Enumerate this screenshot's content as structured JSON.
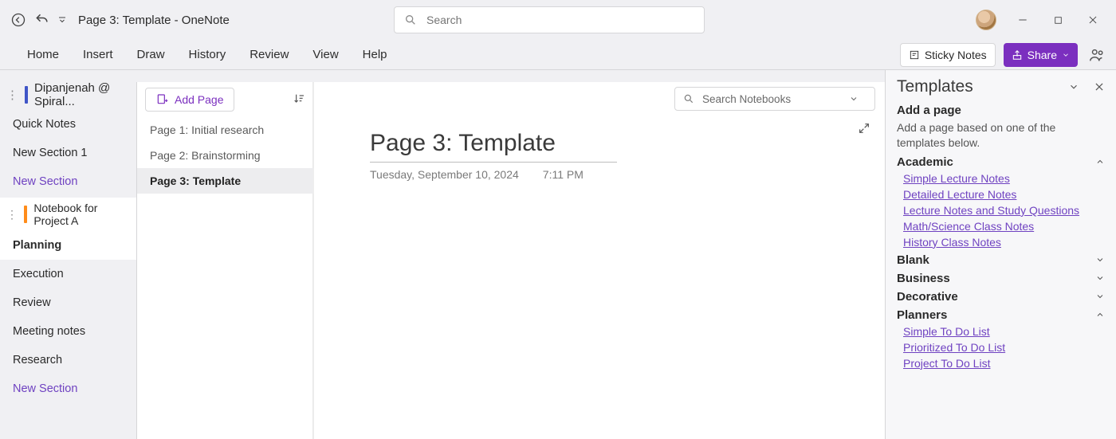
{
  "title": "Page 3: Template  -  OneNote",
  "search_placeholder": "Search",
  "ribbon": {
    "tabs": [
      "Home",
      "Insert",
      "Draw",
      "History",
      "Review",
      "View",
      "Help"
    ],
    "sticky": "Sticky Notes",
    "share": "Share"
  },
  "notebooks": {
    "current": "Dipanjenah @ Spiral...",
    "sections_top": [
      {
        "label": "Quick Notes",
        "new": false
      },
      {
        "label": "New Section 1",
        "new": false
      },
      {
        "label": "New Section",
        "new": true
      }
    ],
    "second_nb": "Notebook for Project A",
    "sections_bottom": [
      {
        "label": "Planning",
        "selected": true
      },
      {
        "label": "Execution"
      },
      {
        "label": "Review"
      },
      {
        "label": "Meeting notes"
      },
      {
        "label": "Research"
      },
      {
        "label": "New Section",
        "new": true
      }
    ]
  },
  "pages": {
    "add_label": "Add Page",
    "items": [
      {
        "label": "Page 1: Initial research"
      },
      {
        "label": "Page 2: Brainstorming"
      },
      {
        "label": "Page 3: Template",
        "selected": true
      }
    ]
  },
  "editor": {
    "search_nb_placeholder": "Search Notebooks",
    "page_title": "Page 3: Template",
    "date": "Tuesday, September 10, 2024",
    "time": "7:11 PM"
  },
  "templates": {
    "panel_title": "Templates",
    "add_page": "Add a page",
    "desc": "Add a page based on one of the templates below.",
    "categories": [
      {
        "name": "Academic",
        "open": true,
        "links": [
          "Simple Lecture Notes",
          "Detailed Lecture Notes",
          "Lecture Notes and Study Questions",
          "Math/Science Class Notes",
          "History Class Notes"
        ]
      },
      {
        "name": "Blank",
        "open": false
      },
      {
        "name": "Business",
        "open": false
      },
      {
        "name": "Decorative",
        "open": false
      },
      {
        "name": "Planners",
        "open": true,
        "links": [
          "Simple To Do List",
          "Prioritized To Do List",
          "Project To Do List"
        ]
      }
    ]
  }
}
